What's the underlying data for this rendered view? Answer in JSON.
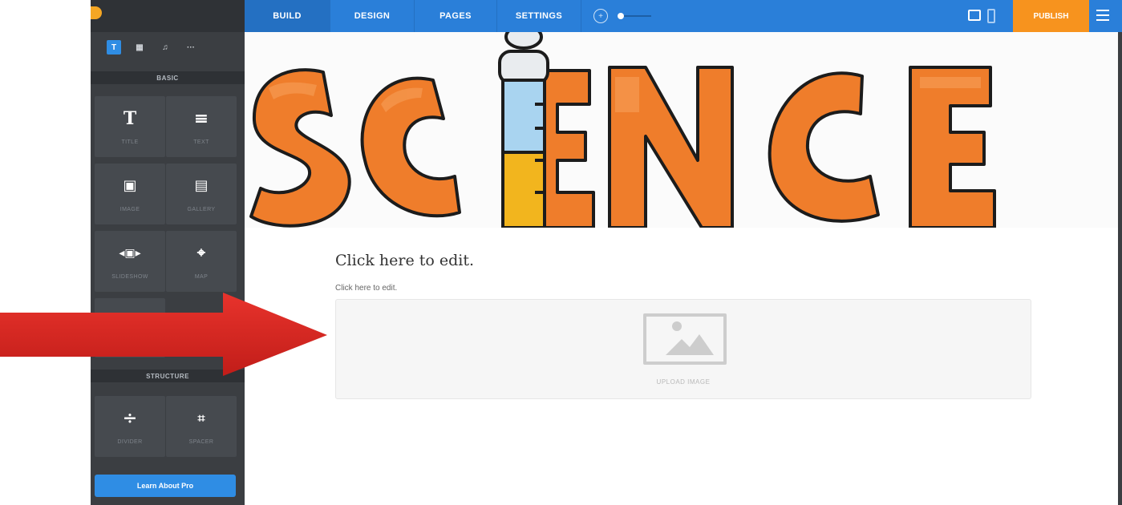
{
  "sidebar": {
    "mode_tabs": [
      {
        "icon": "text-mode-icon",
        "glyph": "T"
      },
      {
        "icon": "layout-mode-icon",
        "glyph": "▦"
      },
      {
        "icon": "music-mode-icon",
        "glyph": "♫"
      },
      {
        "icon": "more-mode-icon",
        "glyph": "···"
      }
    ],
    "basic_header": "BASIC",
    "structure_header": "STRUCTURE",
    "elements": [
      {
        "icon": "title-icon",
        "glyph": "T",
        "label": "TITLE"
      },
      {
        "icon": "text-icon",
        "glyph": "≡",
        "label": "TEXT"
      },
      {
        "icon": "image-icon",
        "glyph": "▣",
        "label": "IMAGE"
      },
      {
        "icon": "gallery-icon",
        "glyph": "▤",
        "label": "GALLERY"
      },
      {
        "icon": "slideshow-icon",
        "glyph": "◂▣▸",
        "label": "SLIDESHOW"
      },
      {
        "icon": "map-pin-icon",
        "glyph": "⌖",
        "label": "MAP"
      },
      {
        "icon": "embed-code-icon",
        "glyph": "</>",
        "label": ""
      }
    ],
    "structure_elements": [
      {
        "icon": "divider-icon",
        "glyph": "÷",
        "label": "DIVIDER"
      },
      {
        "icon": "spacer-icon",
        "glyph": "⌗",
        "label": "SPACER"
      }
    ],
    "pro_button": "Learn About Pro"
  },
  "topbar": {
    "tabs": [
      "BUILD",
      "DESIGN",
      "PAGES",
      "SETTINGS"
    ],
    "publish": "PUBLISH"
  },
  "banner": {
    "word": "SCIENCE"
  },
  "content": {
    "title": "Click here to edit.",
    "subtext": "Click here to edit.",
    "upload_label": "UPLOAD IMAGE"
  },
  "colors": {
    "accent": "#2a7fd9",
    "publish": "#f7931e",
    "sidebar": "#3b3e42",
    "letters": "#ef7d2b",
    "arrow": "#d8241f"
  }
}
